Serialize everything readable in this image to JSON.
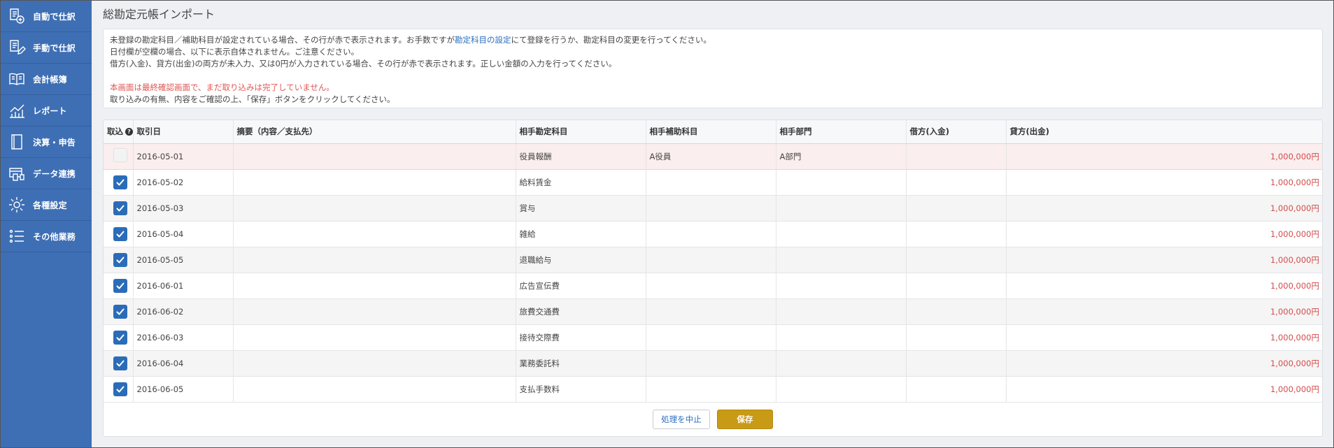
{
  "sidebar": {
    "items": [
      {
        "label": "自動で仕訳",
        "icon": "auto-journal-icon"
      },
      {
        "label": "手動で仕訳",
        "icon": "manual-journal-icon"
      },
      {
        "label": "会計帳簿",
        "icon": "book-icon"
      },
      {
        "label": "レポート",
        "icon": "chart-icon"
      },
      {
        "label": "決算・申告",
        "icon": "document-icon"
      },
      {
        "label": "データ連携",
        "icon": "link-icon"
      },
      {
        "label": "各種設定",
        "icon": "gear-icon"
      },
      {
        "label": "その他業務",
        "icon": "list-icon"
      }
    ]
  },
  "page": {
    "title": "総勘定元帳インポート"
  },
  "notice": {
    "line1_pre": "未登録の勘定科目／補助科目が設定されている場合、その行が赤で表示されます。お手数ですが",
    "line1_link": "勘定科目の設定",
    "line1_post": "にて登録を行うか、勘定科目の変更を行ってください。",
    "line2": "日付欄が空欄の場合、以下に表示自体されません。ご注意ください。",
    "line3": "借方(入金)、貸方(出金)の両方が未入力、又は0円が入力されている場合、その行が赤で表示されます。正しい金額の入力を行ってください。",
    "warning": "本画面は最終確認画面で、まだ取り込みは完了していません。",
    "instruction": "取り込みの有無、内容をご確認の上、「保存」ボタンをクリックしてください。"
  },
  "table": {
    "headers": {
      "import": "取込",
      "date": "取引日",
      "summary": "摘要（内容／支払先）",
      "account": "相手勘定科目",
      "subaccount": "相手補助科目",
      "department": "相手部門",
      "debit": "借方(入金)",
      "credit": "貸方(出金)"
    },
    "rows": [
      {
        "checked": false,
        "date": "2016-05-01",
        "summary": "",
        "account": "役員報酬",
        "subaccount": "A役員",
        "department": "A部門",
        "debit": "",
        "credit": "1,000,000円"
      },
      {
        "checked": true,
        "date": "2016-05-02",
        "summary": "",
        "account": "給料賃金",
        "subaccount": "",
        "department": "",
        "debit": "",
        "credit": "1,000,000円"
      },
      {
        "checked": true,
        "date": "2016-05-03",
        "summary": "",
        "account": "賞与",
        "subaccount": "",
        "department": "",
        "debit": "",
        "credit": "1,000,000円"
      },
      {
        "checked": true,
        "date": "2016-05-04",
        "summary": "",
        "account": "雑給",
        "subaccount": "",
        "department": "",
        "debit": "",
        "credit": "1,000,000円"
      },
      {
        "checked": true,
        "date": "2016-05-05",
        "summary": "",
        "account": "退職給与",
        "subaccount": "",
        "department": "",
        "debit": "",
        "credit": "1,000,000円"
      },
      {
        "checked": true,
        "date": "2016-06-01",
        "summary": "",
        "account": "広告宣伝費",
        "subaccount": "",
        "department": "",
        "debit": "",
        "credit": "1,000,000円"
      },
      {
        "checked": true,
        "date": "2016-06-02",
        "summary": "",
        "account": "旅費交通費",
        "subaccount": "",
        "department": "",
        "debit": "",
        "credit": "1,000,000円"
      },
      {
        "checked": true,
        "date": "2016-06-03",
        "summary": "",
        "account": "接待交際費",
        "subaccount": "",
        "department": "",
        "debit": "",
        "credit": "1,000,000円"
      },
      {
        "checked": true,
        "date": "2016-06-04",
        "summary": "",
        "account": "業務委託料",
        "subaccount": "",
        "department": "",
        "debit": "",
        "credit": "1,000,000円"
      },
      {
        "checked": true,
        "date": "2016-06-05",
        "summary": "",
        "account": "支払手数料",
        "subaccount": "",
        "department": "",
        "debit": "",
        "credit": "1,000,000円"
      }
    ]
  },
  "buttons": {
    "cancel": "処理を中止",
    "save": "保存"
  },
  "colors": {
    "sidebar": "#3e6fb4",
    "checkbox": "#2b6cb8",
    "save": "#c99a16",
    "amount": "#d34b4b",
    "warning": "#e05552",
    "unregistered_row": "#fbeeee"
  }
}
